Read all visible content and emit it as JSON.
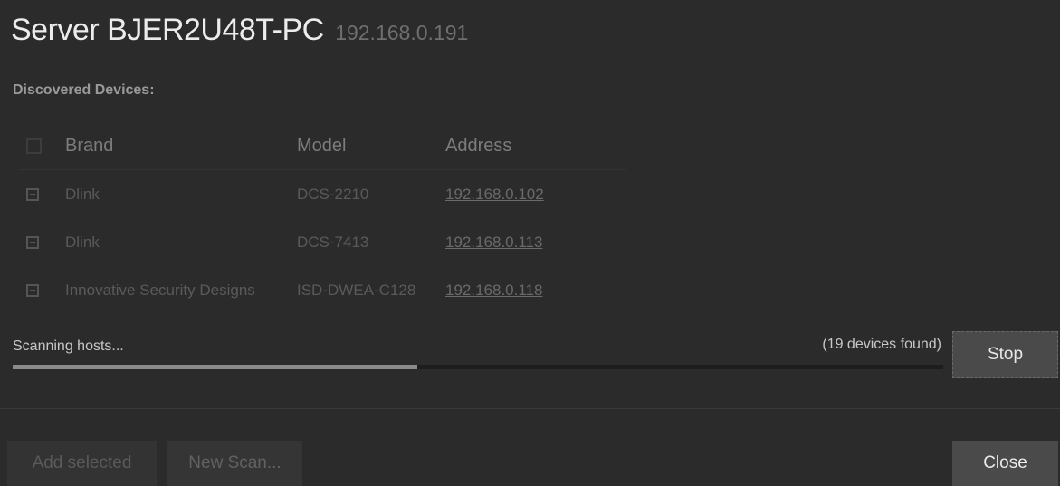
{
  "dialog": {
    "title": "Server BJER2U48T-PC",
    "server_ip": "192.168.0.191",
    "section_label": "Discovered Devices:"
  },
  "table": {
    "columns": {
      "brand": "Brand",
      "model": "Model",
      "address": "Address"
    },
    "rows": [
      {
        "brand": "Dlink",
        "model": "DCS-2210",
        "address": "192.168.0.102"
      },
      {
        "brand": "Dlink",
        "model": "DCS-7413",
        "address": "192.168.0.113"
      },
      {
        "brand": "Innovative Security Designs",
        "model": "ISD-DWEA-C128",
        "address": "192.168.0.118"
      }
    ]
  },
  "scan": {
    "status": "Scanning hosts...",
    "found": "(19 devices found)",
    "progress": 0.435,
    "stop_label": "Stop"
  },
  "footer": {
    "add_selected_label": "Add selected",
    "new_scan_label": "New Scan...",
    "close_label": "Close"
  },
  "icons": {
    "row_checkbox": "checkbox-partial-icon",
    "header_checkbox": "checkbox-empty-icon"
  }
}
